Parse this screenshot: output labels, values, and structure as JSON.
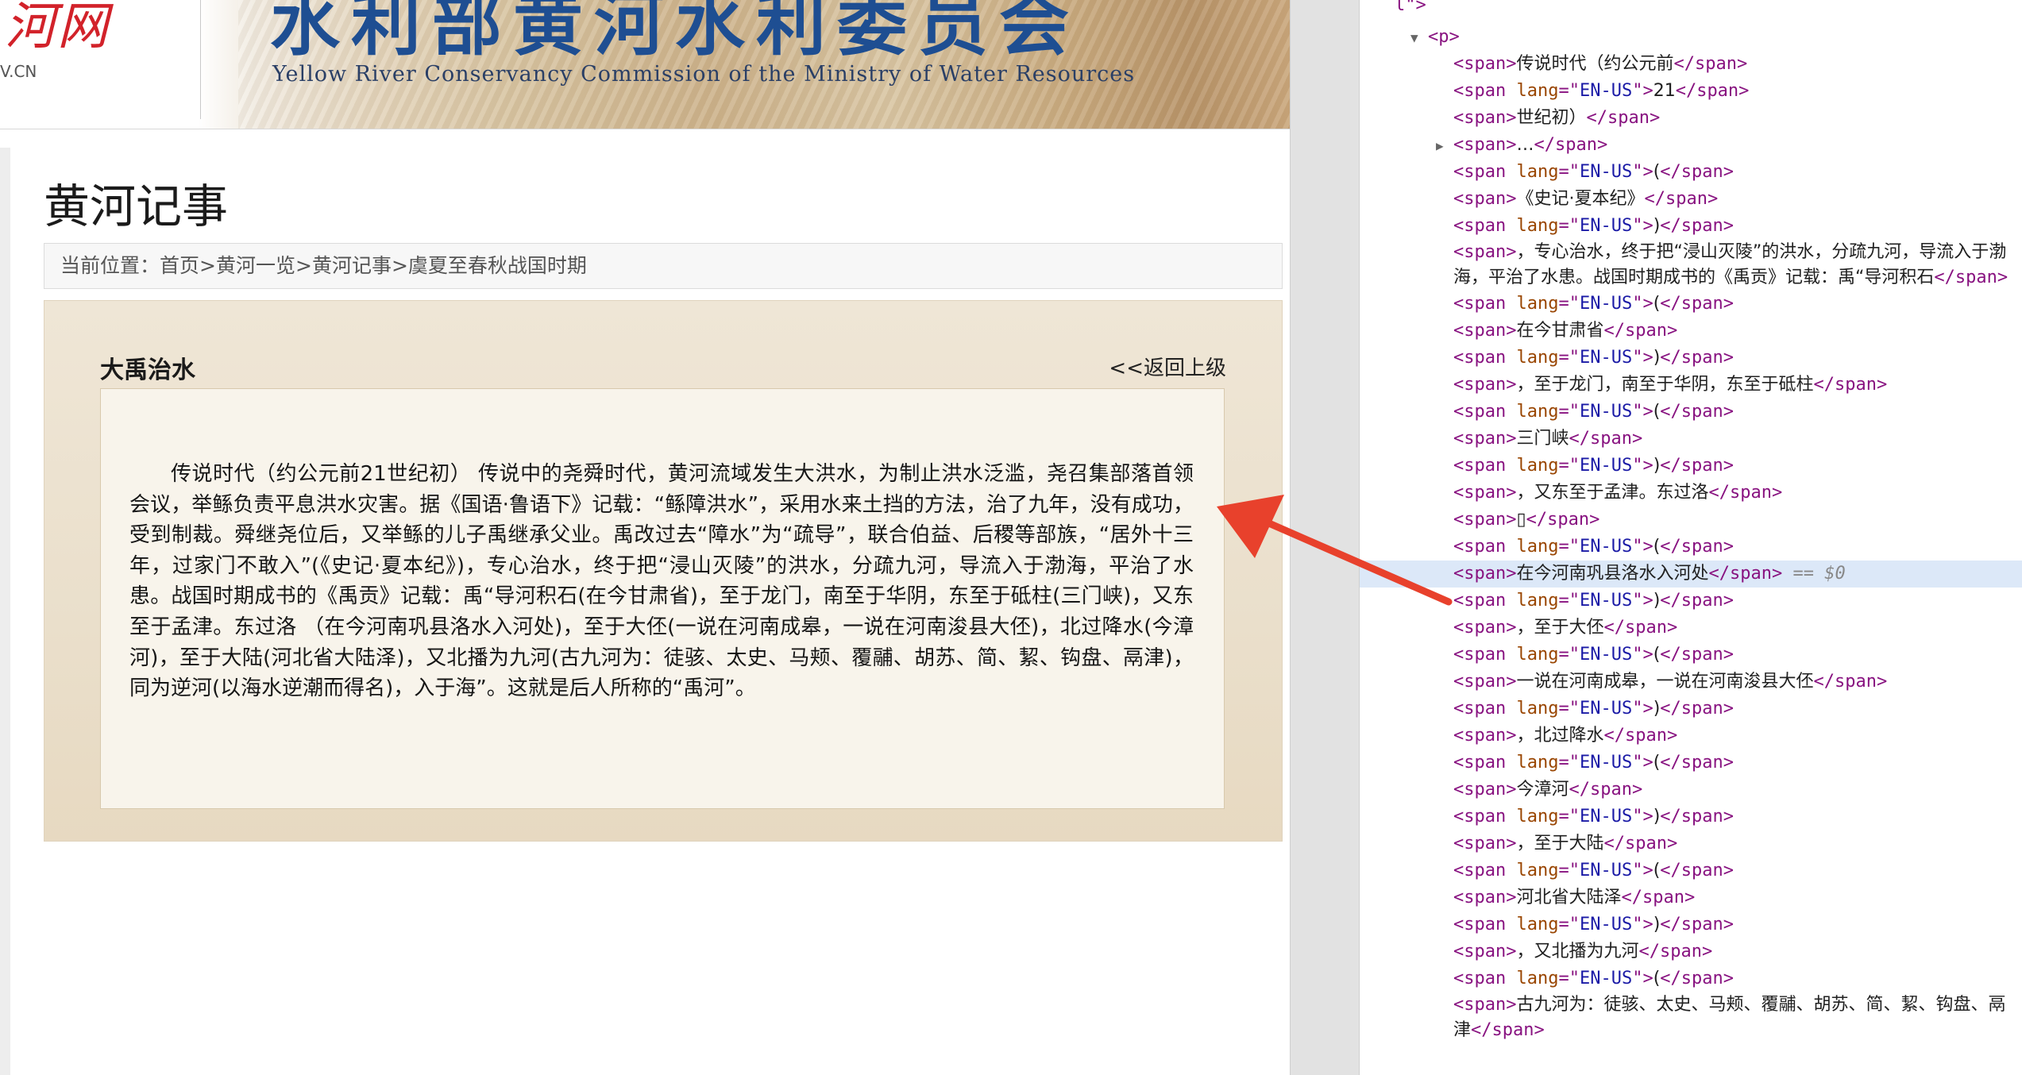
{
  "banner": {
    "logo_text": "河网",
    "logo_domain": "V.CN",
    "title_cn": "水利部黄河水利委员会",
    "title_en": "Yellow River Conservancy Commission of the Ministry of Water Resources"
  },
  "page": {
    "title": "黄河记事",
    "breadcrumb": {
      "prefix": "当前位置：",
      "items": [
        "首页",
        "黄河一览",
        "黄河记事",
        "虞夏至春秋战国时期"
      ],
      "separator": ">"
    },
    "article": {
      "title": "大禹治水",
      "back_label": "<<返回上级",
      "body": "传说时代（约公元前21世纪初） 传说中的尧舜时代，黄河流域发生大洪水，为制止洪水泛滥，尧召集部落首领会议，举鲧负责平息洪水灾害。据《国语·鲁语下》记载：“鲧障洪水”，采用水来土挡的方法，治了九年，没有成功，受到制裁。舜继尧位后，又举鲧的儿子禹继承父业。禹改过去“障水”为“疏导”，联合伯益、后稷等部族，“居外十三年，过家门不敢入”(《史记·夏本纪》)，专心治水，终于把“浸山灭陵”的洪水，分疏九河，导流入于渤海，平治了水患。战国时期成书的《禹贡》记载：禹“导河积石(在今甘肃省)，至于龙门，南至于华阴，东至于砥柱(三门峡)，又东至于孟津。东过洛 （在今河南巩县洛水入河处)，至于大伾(一说在河南成皋，一说在河南浚县大伾)，北过降水(今漳河)，至于大陆(河北省大陆泽)，又北播为九河(古九河为：徒骇、太史、马颊、覆鬴、胡苏、简、絜、钩盘、鬲津)，同为逆河(以海水逆潮而得名)，入于海”。这就是后人所称的“禹河”。"
    }
  },
  "devtools": {
    "top_fragment": "l\">",
    "lines": [
      {
        "indent": 1,
        "tri": "▼",
        "open": "p",
        "text": "",
        "close": ""
      },
      {
        "indent": 2,
        "open": "span",
        "text": "传说时代（约公元前",
        "close": "span"
      },
      {
        "indent": 2,
        "open": "span",
        "lang": "EN-US",
        "text": "21",
        "close": "span"
      },
      {
        "indent": 2,
        "open": "span",
        "text": "世纪初）",
        "close": "span"
      },
      {
        "indent": 2,
        "tri": "▶",
        "open": "span",
        "text": "…",
        "close": "span"
      },
      {
        "indent": 2,
        "open": "span",
        "lang": "EN-US",
        "text": "(",
        "close": "span"
      },
      {
        "indent": 2,
        "open": "span",
        "text": "《史记·夏本纪》",
        "close": "span"
      },
      {
        "indent": 2,
        "open": "span",
        "lang": "EN-US",
        "text": ")",
        "close": "span"
      },
      {
        "indent": 2,
        "open": "span",
        "text": "，专心治水，终于把“浸山灭陵”的洪水，分疏九河，导流入于渤海，平治了水患。战国时期成书的《禹贡》记载：禹“导河积石",
        "close": "span",
        "multi": true
      },
      {
        "indent": 2,
        "open": "span",
        "lang": "EN-US",
        "text": "(",
        "close": "span"
      },
      {
        "indent": 2,
        "open": "span",
        "text": "在今甘肃省",
        "close": "span"
      },
      {
        "indent": 2,
        "open": "span",
        "lang": "EN-US",
        "text": ")",
        "close": "span"
      },
      {
        "indent": 2,
        "open": "span",
        "text": "，至于龙门，南至于华阴，东至于砥柱",
        "close": "span"
      },
      {
        "indent": 2,
        "open": "span",
        "lang": "EN-US",
        "text": "(",
        "close": "span"
      },
      {
        "indent": 2,
        "open": "span",
        "text": "三门峡",
        "close": "span"
      },
      {
        "indent": 2,
        "open": "span",
        "lang": "EN-US",
        "text": ")",
        "close": "span"
      },
      {
        "indent": 2,
        "open": "span",
        "text": "，又东至于孟津。东过洛",
        "close": "span"
      },
      {
        "indent": 2,
        "open": "span",
        "text": "",
        "close": "span"
      },
      {
        "indent": 2,
        "open": "span",
        "lang": "EN-US",
        "text": "(",
        "close": "span"
      },
      {
        "indent": 2,
        "open": "span",
        "text": "在今河南巩县洛水入河处",
        "close": "span",
        "selected": true,
        "suffix": "== $0"
      },
      {
        "indent": 2,
        "open": "span",
        "lang": "EN-US",
        "text": ")",
        "close": "span"
      },
      {
        "indent": 2,
        "open": "span",
        "text": "，至于大伾",
        "close": "span"
      },
      {
        "indent": 2,
        "open": "span",
        "lang": "EN-US",
        "text": "(",
        "close": "span"
      },
      {
        "indent": 2,
        "open": "span",
        "text": "一说在河南成皋，一说在河南浚县大伾",
        "close": "span"
      },
      {
        "indent": 2,
        "open": "span",
        "lang": "EN-US",
        "text": ")",
        "close": "span"
      },
      {
        "indent": 2,
        "open": "span",
        "text": "，北过降水",
        "close": "span"
      },
      {
        "indent": 2,
        "open": "span",
        "lang": "EN-US",
        "text": "(",
        "close": "span"
      },
      {
        "indent": 2,
        "open": "span",
        "text": "今漳河",
        "close": "span"
      },
      {
        "indent": 2,
        "open": "span",
        "lang": "EN-US",
        "text": ")",
        "close": "span"
      },
      {
        "indent": 2,
        "open": "span",
        "text": "，至于大陆",
        "close": "span"
      },
      {
        "indent": 2,
        "open": "span",
        "lang": "EN-US",
        "text": "(",
        "close": "span"
      },
      {
        "indent": 2,
        "open": "span",
        "text": "河北省大陆泽",
        "close": "span"
      },
      {
        "indent": 2,
        "open": "span",
        "lang": "EN-US",
        "text": ")",
        "close": "span"
      },
      {
        "indent": 2,
        "open": "span",
        "text": "，又北播为九河",
        "close": "span"
      },
      {
        "indent": 2,
        "open": "span",
        "lang": "EN-US",
        "text": "(",
        "close": "span"
      },
      {
        "indent": 2,
        "open": "span",
        "text": "古九河为：徒骇、太史、马颊、覆鬴、胡苏、简、絜、钩盘、鬲津",
        "close": "span",
        "multi": true
      }
    ]
  },
  "colors": {
    "annotation_arrow": "#e8412c",
    "banner_title": "#1e4e92",
    "selected_row": "#dce8f8"
  }
}
